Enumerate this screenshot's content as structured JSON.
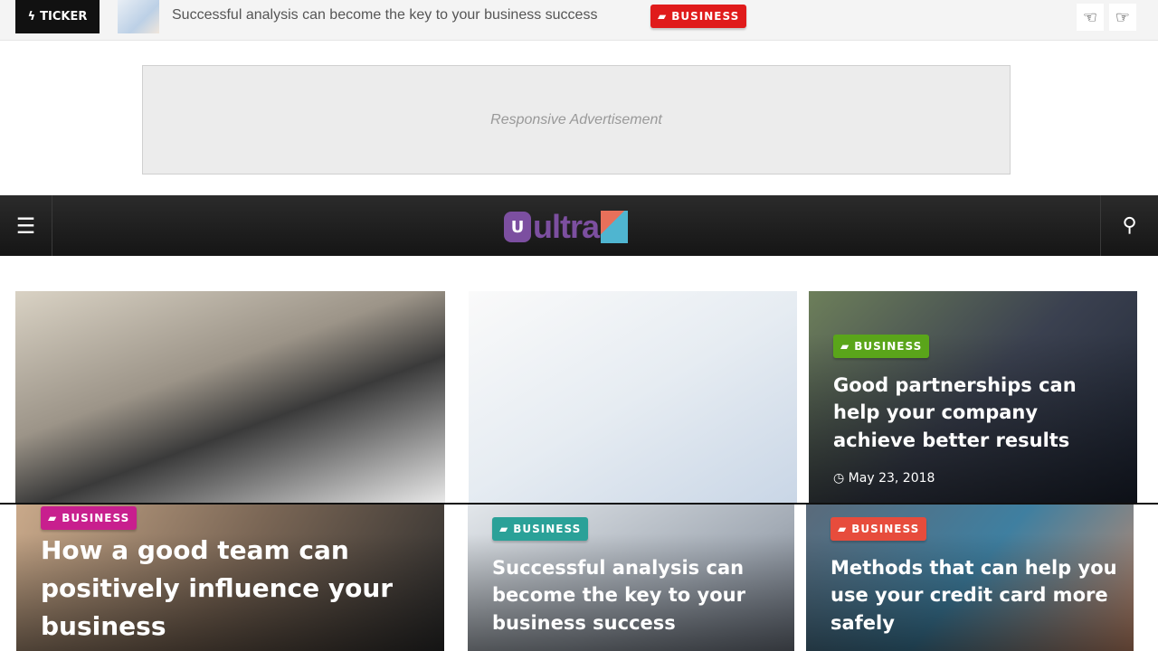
{
  "ticker": {
    "label": "TICKER",
    "text": "Successful analysis can become the key to your business success",
    "category": "BUSINESS",
    "category_color": "#e01b1b"
  },
  "ad": {
    "text": "Responsive Advertisement"
  },
  "header": {
    "logo_text": "ultra",
    "logo_letter": "U",
    "brand_color": "#7c4fa0"
  },
  "posts": [
    {
      "category": "BUSINESS",
      "color": "#5aa51a",
      "title": "Good partnerships can help your company achieve better results",
      "date": "May 23, 2018"
    },
    {
      "category": "BUSINESS",
      "color": "#c81f8e",
      "title": "How a good team can positively influence your business"
    },
    {
      "category": "BUSINESS",
      "color": "#2aa198",
      "title": "Successful analysis can become the key to your business success"
    },
    {
      "category": "BUSINESS",
      "color": "#e74c3c",
      "title": "Methods that can help you use your credit card more safely"
    }
  ]
}
